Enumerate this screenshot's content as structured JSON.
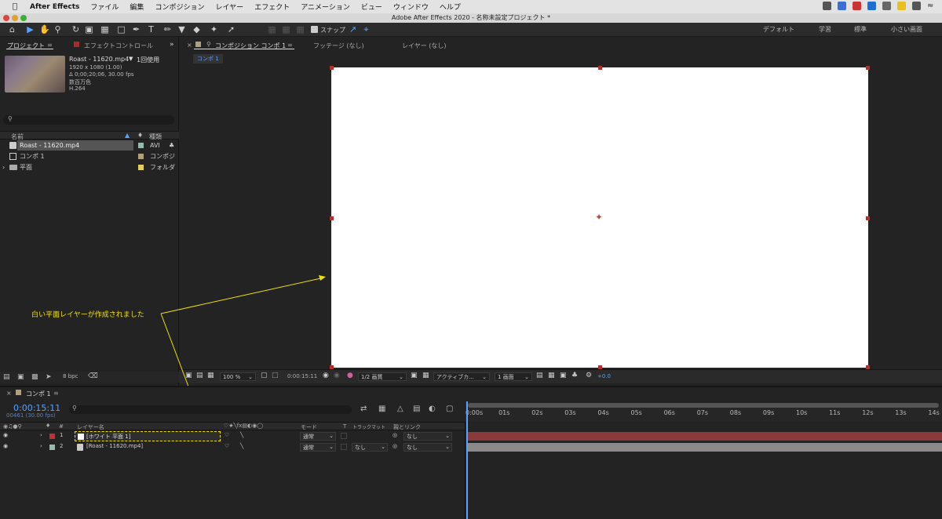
{
  "menubar": {
    "app_name": "After Effects",
    "items": [
      "ファイル",
      "編集",
      "コンポジション",
      "レイヤー",
      "エフェクト",
      "アニメーション",
      "ビュー",
      "ウィンドウ",
      "ヘルプ"
    ]
  },
  "window_title": "Adobe After Effects 2020 - 名称未設定プロジェクト *",
  "toolbar": {
    "snap_label": "スナップ",
    "workspaces": [
      "デフォルト",
      "学習",
      "標準",
      "小さい画面"
    ]
  },
  "project": {
    "tab_project": "プロジェクト",
    "tab_effects": "エフェクトコントロール",
    "footage_name": "Roast - 11620.mp4",
    "footage_used": "1回使用",
    "footage_size": "1920 x 1080 (1.00)",
    "footage_duration": "Δ 0;00;20;06, 30.00 fps",
    "footage_colors": "数百万色",
    "footage_codec": "H.264",
    "col_name": "名前",
    "col_type": "種類",
    "items": [
      {
        "name": "Roast - 11620.mp4",
        "type": "AVI"
      },
      {
        "name": "コンポ 1",
        "type": "コンポジ"
      },
      {
        "name": "平面",
        "type": "フォルダ"
      }
    ],
    "bpc": "8 bpc"
  },
  "viewer": {
    "tab_comp": "コンポジション コンポ 1",
    "tab_footage": "フッテージ (なし)",
    "tab_layer": "レイヤー (なし)",
    "sub_tab": "コンポ 1",
    "zoom": "100 %",
    "timecode": "0:00:15:11",
    "resolution": "1/2 画質",
    "camera": "アクティブカ...",
    "views": "1 画面",
    "exposure": "+0.0"
  },
  "annotation": {
    "text": "白い平面レイヤーが作成されました",
    "color": "#f0e000"
  },
  "timeline": {
    "tab": "コンポ 1",
    "current_time": "0:00:15:11",
    "frame_info": "00461 (30.00 fps)",
    "col_hash": "#",
    "col_layer_name": "レイヤー名",
    "col_mode": "モード",
    "col_t": "T",
    "col_trackmatte": "トラックマット",
    "col_parent": "親とリンク",
    "ruler": [
      "0:00s",
      "01s",
      "02s",
      "03s",
      "04s",
      "05s",
      "06s",
      "07s",
      "08s",
      "09s",
      "10s",
      "11s",
      "12s",
      "13s",
      "14s"
    ],
    "layers": [
      {
        "num": "1",
        "name": "[ホワイト 平面 1]",
        "mode": "通常",
        "matte": "",
        "parent": "なし",
        "label_color": "#c03030",
        "bar_color": "#8a3a3a"
      },
      {
        "num": "2",
        "name": "[Roast - 11620.mp4]",
        "mode": "通常",
        "matte": "なし",
        "parent": "なし",
        "label_color": "#9ab8b0",
        "bar_color": "#8a8a8a"
      }
    ]
  }
}
